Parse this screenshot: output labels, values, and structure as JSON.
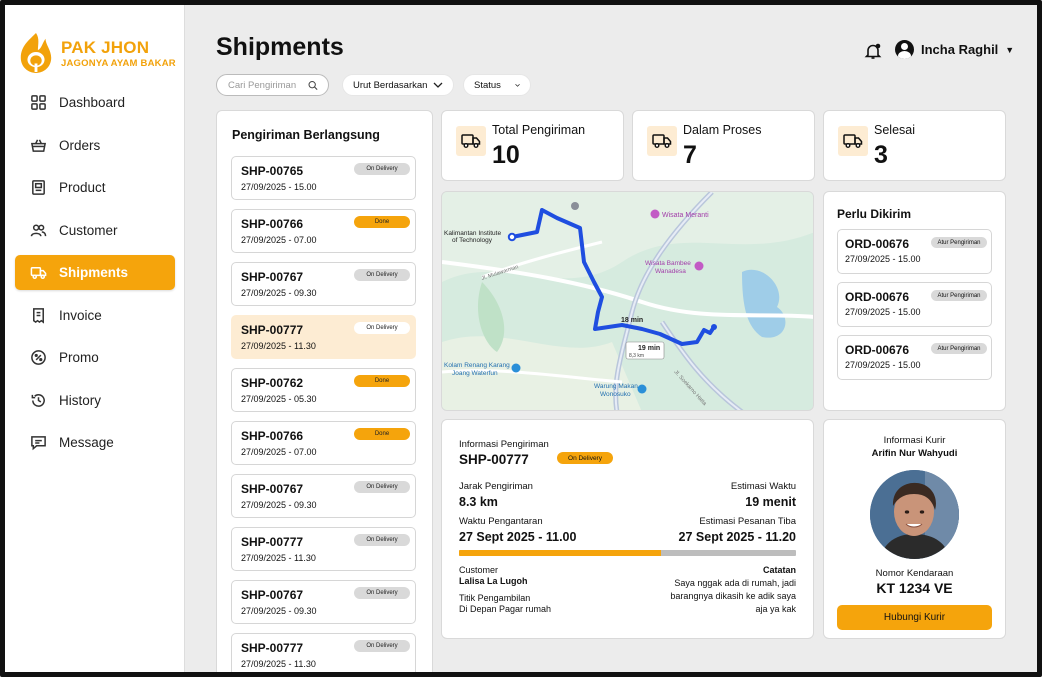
{
  "brand": {
    "title": "PAK JHON",
    "subtitle": "JAGONYA AYAM BAKAR"
  },
  "sidebar": {
    "items": [
      {
        "label": "Dashboard",
        "icon": "grid-icon"
      },
      {
        "label": "Orders",
        "icon": "basket-icon"
      },
      {
        "label": "Product",
        "icon": "product-icon"
      },
      {
        "label": "Customer",
        "icon": "users-icon"
      },
      {
        "label": "Shipments",
        "icon": "truck-icon",
        "active": true
      },
      {
        "label": "Invoice",
        "icon": "receipt-icon"
      },
      {
        "label": "Promo",
        "icon": "percent-icon"
      },
      {
        "label": "History",
        "icon": "history-icon"
      },
      {
        "label": "Message",
        "icon": "message-icon"
      }
    ]
  },
  "header": {
    "title": "Shipments",
    "user_name": "Incha Raghil"
  },
  "filters": {
    "search_placeholder": "Cari Pengiriman",
    "sort_label": "Urut Berdasarkan",
    "status_label": "Status"
  },
  "list": {
    "title": "Pengiriman Berlangsung",
    "items": [
      {
        "id": "SHP-00765",
        "date": "27/09/2025 - 15.00",
        "status": "On Delivery"
      },
      {
        "id": "SHP-00766",
        "date": "27/09/2025 - 07.00",
        "status": "Done"
      },
      {
        "id": "SHP-00767",
        "date": "27/09/2025 - 09.30",
        "status": "On Delivery"
      },
      {
        "id": "SHP-00777",
        "date": "27/09/2025 - 11.30",
        "status": "On Delivery"
      },
      {
        "id": "SHP-00762",
        "date": "27/09/2025 - 05.30",
        "status": "Done"
      },
      {
        "id": "SHP-00766",
        "date": "27/09/2025 - 07.00",
        "status": "Done"
      },
      {
        "id": "SHP-00767",
        "date": "27/09/2025 - 09.30",
        "status": "On Delivery"
      },
      {
        "id": "SHP-00777",
        "date": "27/09/2025 - 11.30",
        "status": "On Delivery"
      },
      {
        "id": "SHP-00767",
        "date": "27/09/2025 - 09.30",
        "status": "On Delivery"
      },
      {
        "id": "SHP-00777",
        "date": "27/09/2025 - 11.30",
        "status": "On Delivery"
      }
    ]
  },
  "stats": [
    {
      "label": "Total Pengiriman",
      "value": "10"
    },
    {
      "label": "Dalam Proses",
      "value": "7"
    },
    {
      "label": "Selesai",
      "value": "3"
    }
  ],
  "map": {
    "labels": {
      "origin_line1": "Kalimantan Institute",
      "origin_line2": "of Technology",
      "poi1": "Wisata Meranti",
      "poi2_line1": "Wisata Bambee",
      "poi2_line2": "Wanadesa",
      "poi3_line1": "Kolam Renang Karang",
      "poi3_line2": "Joang Waterfun",
      "poi4_line1": "Warung Makan",
      "poi4_line2": "Wonosuko",
      "route_time_1": "18 min",
      "route_time_2": "19 min",
      "route_dist": "8,3 km",
      "road1": "Jl. Mulawarman",
      "road2": "Jl. Soekarno Hatta"
    }
  },
  "todo": {
    "title": "Perlu Dikirim",
    "items": [
      {
        "id": "ORD-00676",
        "date": "27/09/2025 - 15.00",
        "action": "Atur Pengiriman"
      },
      {
        "id": "ORD-00676",
        "date": "27/09/2025 - 15.00",
        "action": "Atur Pengiriman"
      },
      {
        "id": "ORD-00676",
        "date": "27/09/2025 - 15.00",
        "action": "Atur Pengiriman"
      }
    ]
  },
  "detail": {
    "heading": "Informasi Pengiriman",
    "id": "SHP-00777",
    "status": "On Delivery",
    "distance_label": "Jarak Pengiriman",
    "distance": "8.3 km",
    "eta_label": "Estimasi Waktu",
    "eta": "19 menit",
    "sent_label": "Waktu Pengantaran",
    "sent": "27 Sept 2025 - 11.00",
    "arrive_label": "Estimasi Pesanan Tiba",
    "arrive": "27 Sept 2025 - 11.20",
    "progress": 0.6,
    "customer_label": "Customer",
    "customer": "Lalisa La Lugoh",
    "pickup_label": "Titik Pengambilan",
    "pickup": "Di Depan Pagar rumah",
    "note_label": "Catatan",
    "note_line1": "Saya nggak ada di rumah, jadi",
    "note_line2": "barangnya dikasih ke adik saya",
    "note_line3": "aja ya kak"
  },
  "courier": {
    "heading": "Informasi Kurir",
    "name": "Arifin Nur Wahyudi",
    "plate_label": "Nomor Kendaraan",
    "plate": "KT 1234 VE",
    "button": "Hubungi Kurir"
  },
  "colors": {
    "accent": "#f5a40c",
    "accent_soft": "#fdecd3",
    "brand": "#f2a20b",
    "route": "#1f4ee0"
  }
}
